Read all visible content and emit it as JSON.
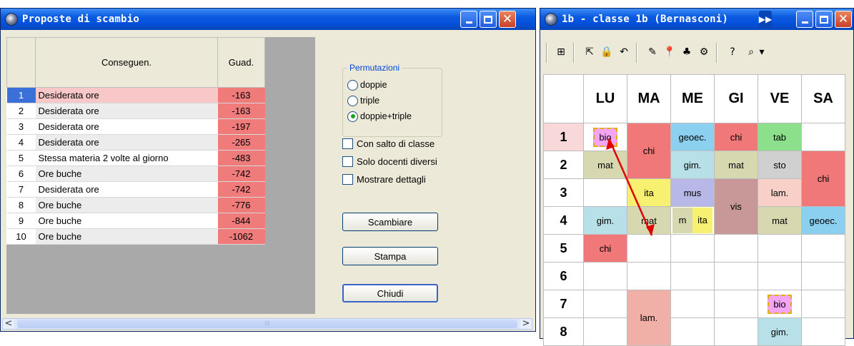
{
  "left_window": {
    "title": "Proposte di scambio",
    "table": {
      "headers": [
        "",
        "Conseguen.",
        "Guad."
      ],
      "rows": [
        {
          "n": "1",
          "conseguenza": "Desiderata ore",
          "guadagno": "-163"
        },
        {
          "n": "2",
          "conseguenza": "Desiderata ore",
          "guadagno": "-163"
        },
        {
          "n": "3",
          "conseguenza": "Desiderata ore",
          "guadagno": "-197"
        },
        {
          "n": "4",
          "conseguenza": "Desiderata ore",
          "guadagno": "-265"
        },
        {
          "n": "5",
          "conseguenza": "Stessa materia 2 volte al giorno",
          "guadagno": "-483"
        },
        {
          "n": "6",
          "conseguenza": "Ore buche",
          "guadagno": "-742"
        },
        {
          "n": "7",
          "conseguenza": "Desiderata ore",
          "guadagno": "-742"
        },
        {
          "n": "8",
          "conseguenza": "Ore buche",
          "guadagno": "-776"
        },
        {
          "n": "9",
          "conseguenza": "Ore buche",
          "guadagno": "-844"
        },
        {
          "n": "10",
          "conseguenza": "Ore buche",
          "guadagno": "-1062"
        }
      ]
    },
    "permutazioni": {
      "legend": "Permutazioni",
      "options": [
        "doppie",
        "triple",
        "doppie+triple"
      ],
      "selected": "doppie+triple"
    },
    "checkboxes": [
      "Con salto di classe",
      "Solo docenti diversi",
      "Mostrare dettagli"
    ],
    "buttons": {
      "scambiare": "Scambiare",
      "stampa": "Stampa",
      "chiudi": "Chiudi"
    },
    "scroll": {
      "left": "<",
      "right": ">",
      "grip": "III"
    }
  },
  "right_window": {
    "title": "1b - classe 1b (Bernasconi)",
    "days": [
      "LU",
      "MA",
      "ME",
      "GI",
      "VE",
      "SA"
    ],
    "periods": [
      "1",
      "2",
      "3",
      "4",
      "5",
      "6",
      "7",
      "8"
    ],
    "lessons": {
      "lu1": "bio",
      "lu2": "mat",
      "lu4": "gim.",
      "lu5": "chi",
      "ma12": "chi",
      "ma3": "ita",
      "ma4": "mat",
      "ma78": "lam.",
      "me1": "geoec.",
      "me2": "gim.",
      "me3": "mus",
      "me4a": "m",
      "me4b": "ita",
      "gi1": "chi",
      "gi2": "mat",
      "gi34": "vis",
      "ve1": "tab",
      "ve2": "sto",
      "ve3": "lam.",
      "ve4": "mat",
      "ve7": "bio",
      "ve8": "gim.",
      "sa23": "chi",
      "sa4": "geoec."
    }
  },
  "colors": {
    "titlebar": "#0a5ae0",
    "gain_cell": "#f07b7b",
    "selected_row": "#3a70d8"
  }
}
